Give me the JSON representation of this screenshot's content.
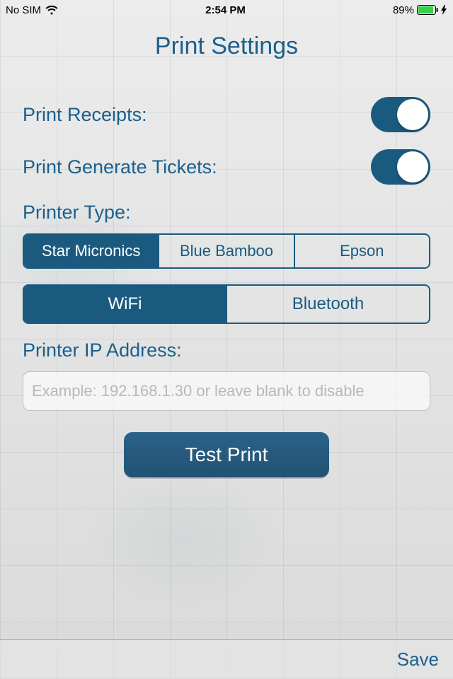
{
  "status_bar": {
    "carrier": "No SIM",
    "time": "2:54 PM",
    "battery_pct": "89%"
  },
  "header": {
    "title": "Print Settings"
  },
  "toggles": {
    "print_receipts_label": "Print Receipts:",
    "print_receipts_on": true,
    "print_generate_tickets_label": "Print Generate Tickets:",
    "print_generate_tickets_on": true
  },
  "printer_type": {
    "label": "Printer Type:",
    "options": [
      "Star Micronics",
      "Blue Bamboo",
      "Epson"
    ],
    "selected_index": 0
  },
  "connection": {
    "options": [
      "WiFi",
      "Bluetooth"
    ],
    "selected_index": 0
  },
  "ip_section": {
    "label": "Printer IP Address:",
    "placeholder": "Example: 192.168.1.30 or leave blank to disable",
    "value": ""
  },
  "buttons": {
    "test_print": "Test Print",
    "save": "Save"
  },
  "colors": {
    "accent": "#1b5a7f",
    "accent_text": "#1b5f8e"
  }
}
